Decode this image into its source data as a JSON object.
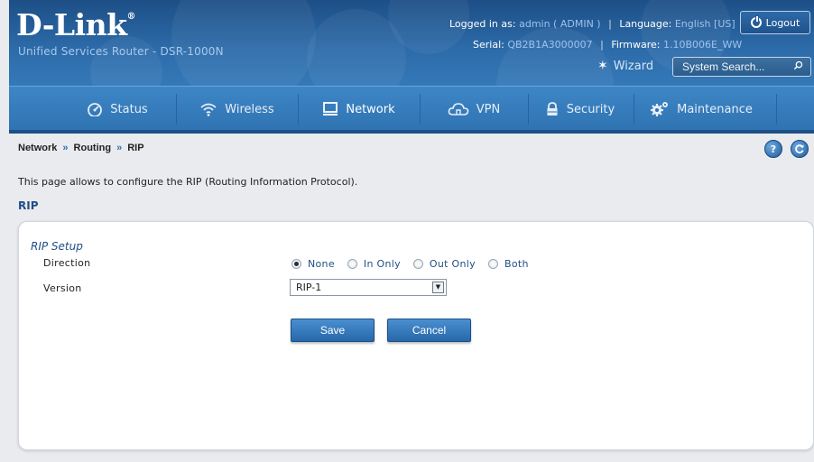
{
  "header": {
    "logo_text": "D-Link",
    "logo_mark": "®",
    "subtitle": "Unified Services Router - DSR-1000N",
    "logged_in_label": "Logged in as:",
    "logged_in_value": "admin ( ADMIN )",
    "language_label": "Language:",
    "language_value": "English [US]",
    "serial_label": "Serial:",
    "serial_value": "QB2B1A3000007",
    "firmware_label": "Firmware:",
    "firmware_value": "1.10B006E_WW",
    "logout_label": "Logout",
    "wizard_label": "Wizard",
    "search_placeholder": "System Search..."
  },
  "nav": {
    "tabs": [
      {
        "label": "Status",
        "icon": "gauge-icon"
      },
      {
        "label": "Wireless",
        "icon": "wifi-icon"
      },
      {
        "label": "Network",
        "icon": "monitor-icon"
      },
      {
        "label": "VPN",
        "icon": "cloud-icon"
      },
      {
        "label": "Security",
        "icon": "lock-icon"
      },
      {
        "label": "Maintenance",
        "icon": "gears-icon"
      }
    ],
    "active": "Network"
  },
  "breadcrumb": {
    "items": [
      "Network",
      "Routing",
      "RIP"
    ],
    "separator": "»"
  },
  "help_icon": "?",
  "description": "This page allows to configure the RIP (Routing Information Protocol).",
  "section_title": "RIP",
  "form": {
    "title": "RIP Setup",
    "direction_label": "Direction",
    "direction_options": [
      "None",
      "In Only",
      "Out Only",
      "Both"
    ],
    "direction_selected": "None",
    "version_label": "Version",
    "version_value": "RIP-1",
    "save_label": "Save",
    "cancel_label": "Cancel"
  },
  "colors": {
    "header_bg": "#245d98",
    "nav_bg": "#3579b9",
    "accent_text": "#1e4f86",
    "button_bg": "#2f73b2"
  }
}
